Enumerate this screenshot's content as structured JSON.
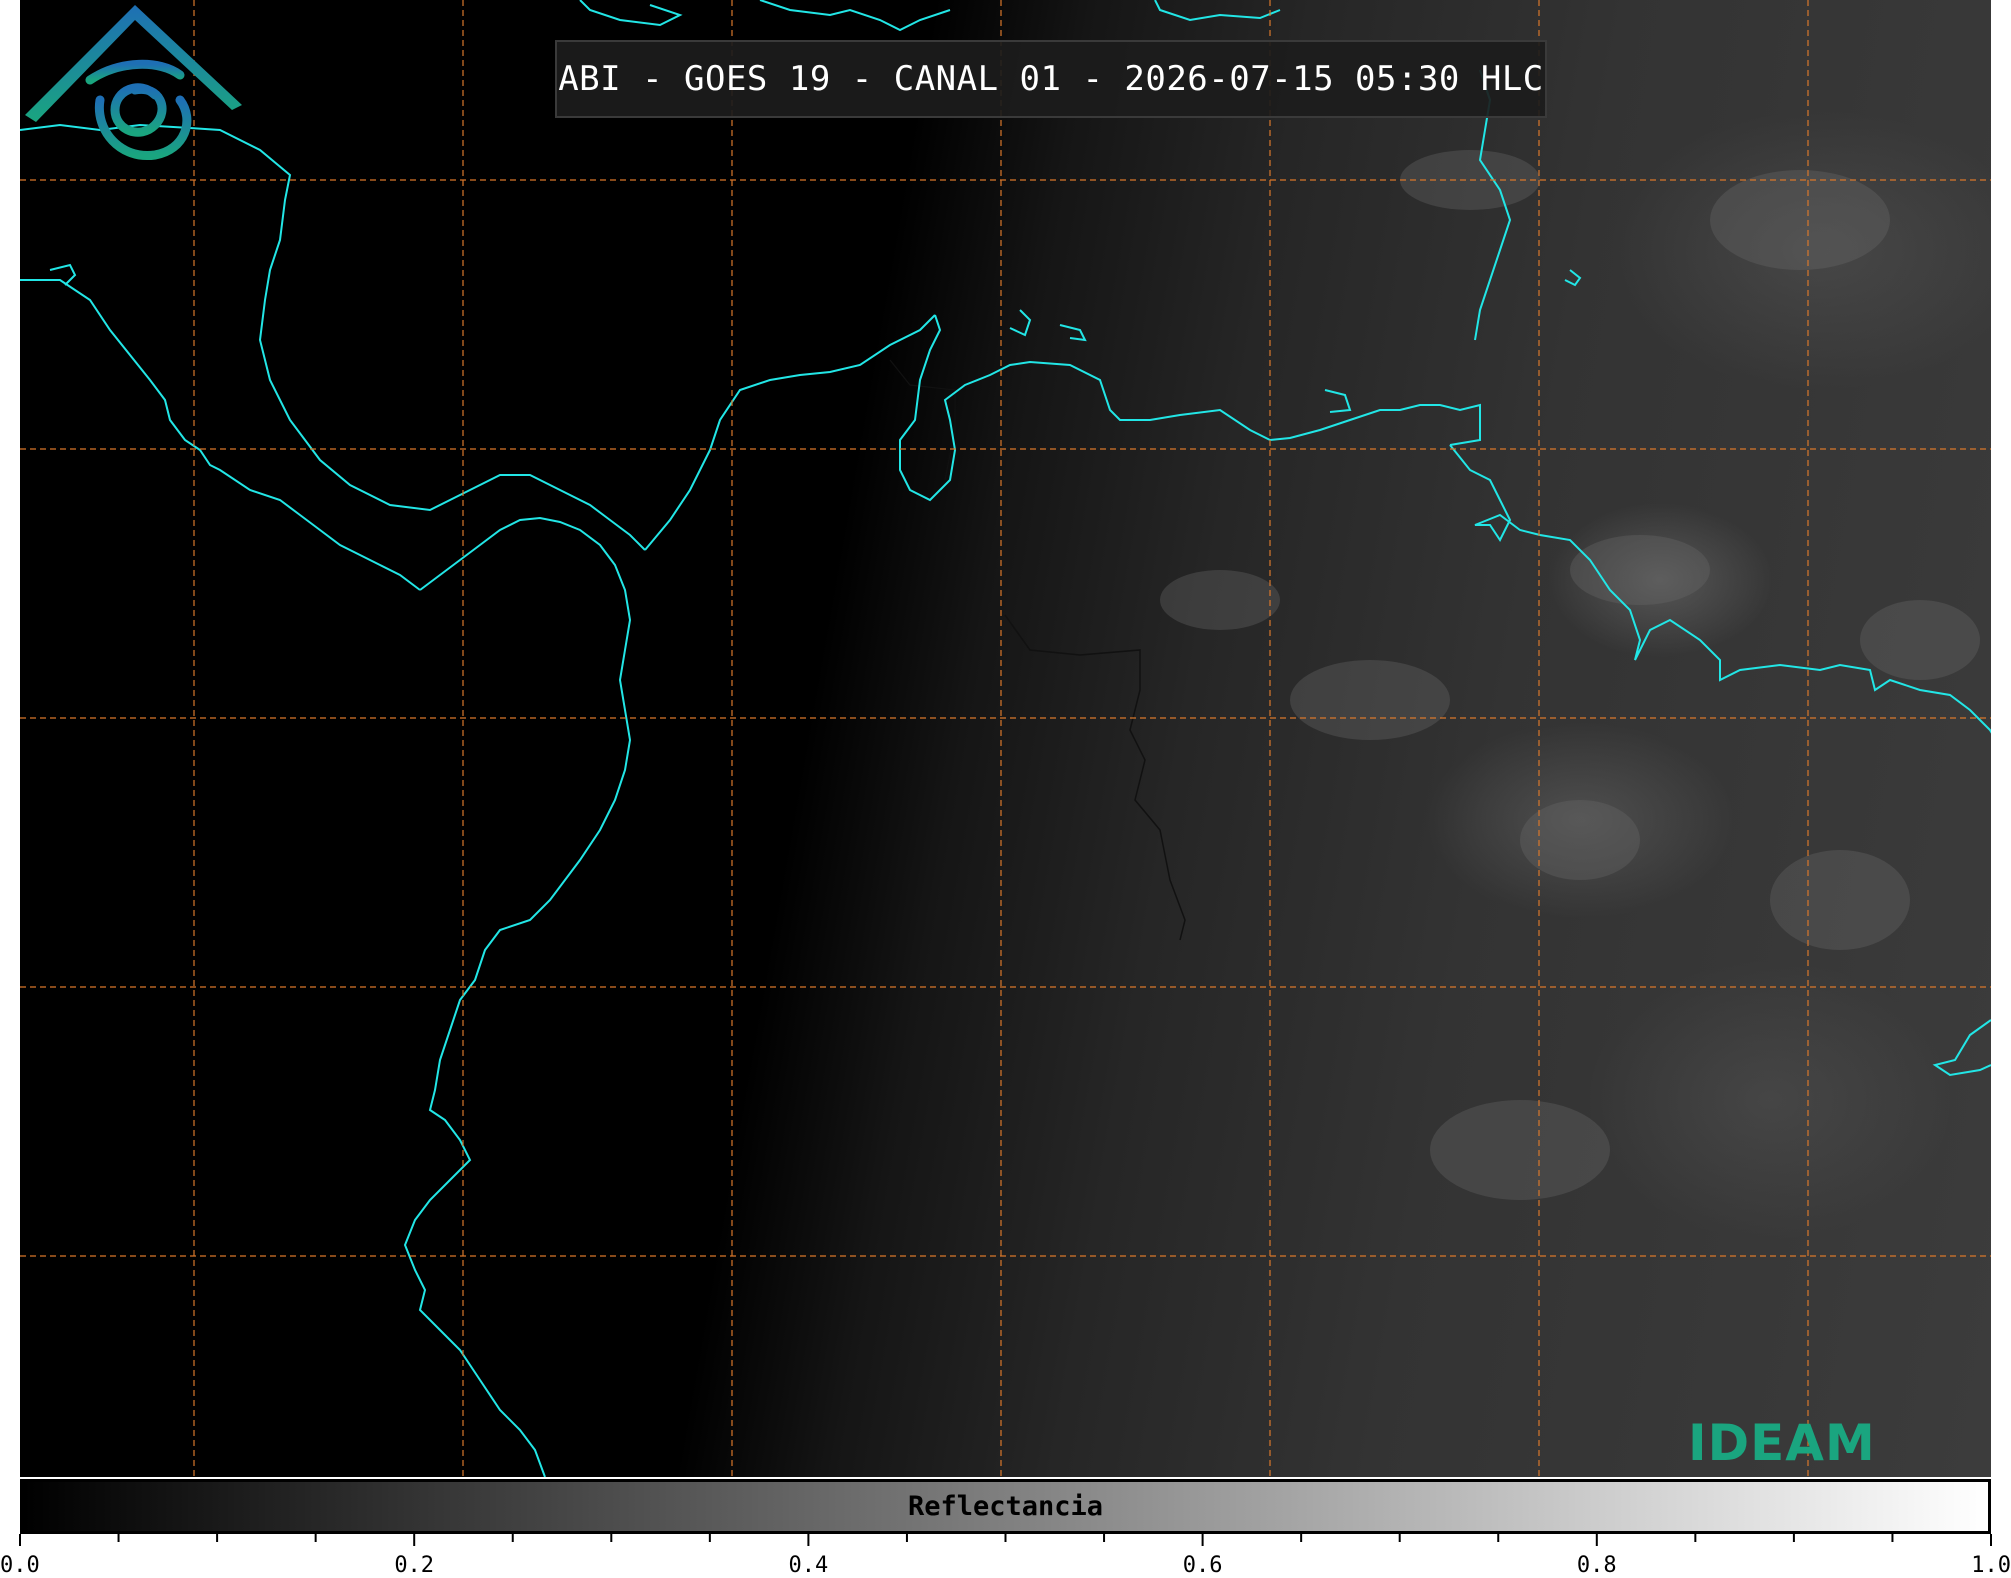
{
  "title": "ABI - GOES 19 - CANAL 01 - 2026-07-15 05:30 HLC",
  "colors": {
    "coastline": "#22e6e6",
    "borders": "#111111",
    "graticule": "#d9772b",
    "logo_blue": "#1e6fb5",
    "logo_green": "#1aa57f"
  },
  "map": {
    "layers": [
      "satellite-reflectance-image",
      "coastlines",
      "country-borders",
      "graticule"
    ],
    "graticule_style": "dashed"
  },
  "logo": {
    "text": "IDEAM"
  },
  "colorbar": {
    "label": "Reflectancia",
    "colormap": "grayscale",
    "range": [
      0.0,
      1.0
    ],
    "tick_labels": [
      "0.0",
      "0.2",
      "0.4",
      "0.6",
      "0.8",
      "1.0"
    ]
  }
}
